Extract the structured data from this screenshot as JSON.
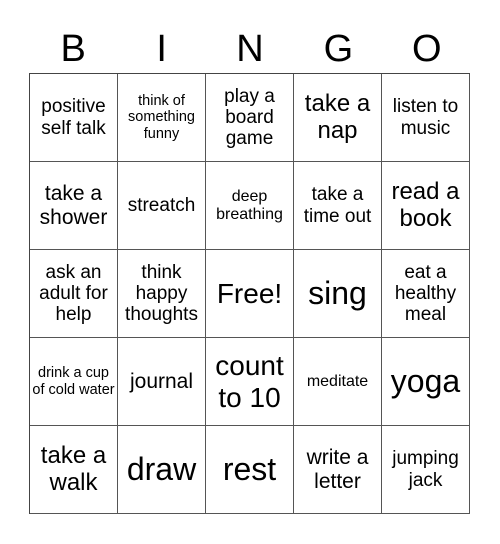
{
  "header": {
    "letters": [
      "B",
      "I",
      "N",
      "G",
      "O"
    ]
  },
  "card": {
    "rows": [
      [
        {
          "text": "positive self talk",
          "size": "s-md"
        },
        {
          "text": "think of something funny",
          "size": "s-xs"
        },
        {
          "text": "play a board game",
          "size": "s-md"
        },
        {
          "text": "take a nap",
          "size": "s-lg"
        },
        {
          "text": "listen to music",
          "size": "s-md"
        }
      ],
      [
        {
          "text": "take a shower",
          "size": "s-md2"
        },
        {
          "text": "streatch",
          "size": "s-md"
        },
        {
          "text": "deep breathing",
          "size": "s-sm"
        },
        {
          "text": "take a time out",
          "size": "s-md"
        },
        {
          "text": "read a book",
          "size": "s-lg"
        }
      ],
      [
        {
          "text": "ask an adult for help",
          "size": "s-md"
        },
        {
          "text": "think happy thoughts",
          "size": "s-md"
        },
        {
          "text": "Free!",
          "size": "s-xl"
        },
        {
          "text": "sing",
          "size": "s-xxl"
        },
        {
          "text": "eat a healthy meal",
          "size": "s-md"
        }
      ],
      [
        {
          "text": "drink a cup of cold water",
          "size": "s-xs"
        },
        {
          "text": "journal",
          "size": "s-md2"
        },
        {
          "text": "count to 10",
          "size": "s-xl"
        },
        {
          "text": "meditate",
          "size": "s-sm"
        },
        {
          "text": "yoga",
          "size": "s-xxl"
        }
      ],
      [
        {
          "text": "take a walk",
          "size": "s-lg"
        },
        {
          "text": "draw",
          "size": "s-xxl"
        },
        {
          "text": "rest",
          "size": "s-xxl"
        },
        {
          "text": "write a letter",
          "size": "s-md2"
        },
        {
          "text": "jumping jack",
          "size": "s-md"
        }
      ]
    ]
  }
}
